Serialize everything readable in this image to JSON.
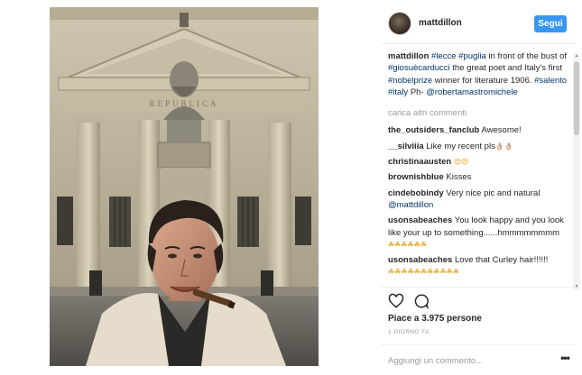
{
  "post": {
    "image_alt": "Selfie of a man with a cigar in front of a bust on a classical facade",
    "building_inscription": "REPUBLICA",
    "header": {
      "username": "mattdillon",
      "follow_label": "Segui"
    },
    "caption": {
      "username": "mattdillon",
      "parts": [
        {
          "t": "#lecce",
          "tag": true
        },
        {
          "t": " ",
          "tag": false
        },
        {
          "t": "#puglia",
          "tag": true
        },
        {
          "t": " in front of the bust of ",
          "tag": false
        },
        {
          "t": "#giosuècarducci",
          "tag": true
        },
        {
          "t": " the great poet and Italy's first ",
          "tag": false
        },
        {
          "t": "#nobelprize",
          "tag": true
        },
        {
          "t": " winner for literature 1906. ",
          "tag": false
        },
        {
          "t": "#salento",
          "tag": true
        },
        {
          "t": " ",
          "tag": false
        },
        {
          "t": "#italy",
          "tag": true
        },
        {
          "t": " Ph- ",
          "tag": false
        },
        {
          "t": "@robertamastromichele",
          "tag": true
        }
      ]
    },
    "load_more": "carica altri commenti",
    "comments": [
      {
        "user": "the_outsiders_fanclub",
        "parts": [
          {
            "t": "Awesome!",
            "tag": false
          }
        ]
      },
      {
        "user": "__silviiia",
        "parts": [
          {
            "t": "Like my recent pls",
            "tag": false
          }
        ],
        "emoji": "👌🏼👌🏼"
      },
      {
        "user": "christinaausten",
        "parts": [],
        "emoji": "😍😍"
      },
      {
        "user": "brownishblue",
        "parts": [
          {
            "t": "Kisses",
            "tag": false
          }
        ]
      },
      {
        "user": "cindebobindy",
        "parts": [
          {
            "t": "Very nice pic and natural ",
            "tag": false
          },
          {
            "t": "@mattdillon",
            "tag": true
          }
        ]
      },
      {
        "user": "usonsabeaches",
        "parts": [
          {
            "t": "You look happy and you look like your up to something......hmmmmmmmm",
            "tag": false
          }
        ],
        "emoji": "☘☘☘☘☘☘"
      },
      {
        "user": "usonsabeaches",
        "parts": [
          {
            "t": "Love that Curley hair!!!!!!",
            "tag": false
          }
        ],
        "emoji": "☘☘☘☘☘☘☘☘☘☘☘"
      }
    ],
    "icons": {
      "like": "heart-icon",
      "comment": "comment-bubble-icon",
      "more": "more-options-icon"
    },
    "likes_text": "Piace a 3.975 persone",
    "date_text": "1 GIORNO FA",
    "add_comment_placeholder": "Aggiungi un commento...",
    "more_label": "•••",
    "colors": {
      "follow_button": "#3897f0",
      "hashtag": "#003569",
      "username": "#262626",
      "muted": "#999999"
    }
  }
}
